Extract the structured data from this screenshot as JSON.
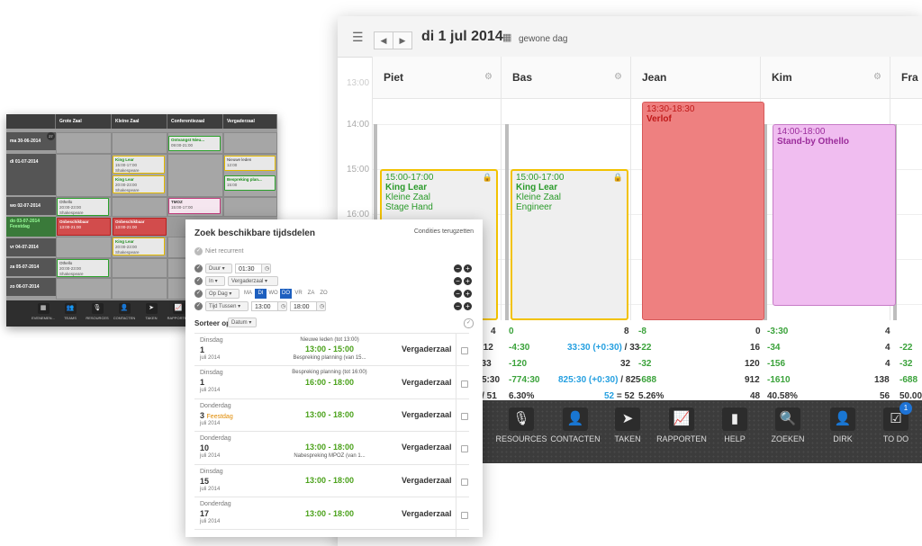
{
  "calendar": {
    "date_title": "di 1 jul 2014",
    "day_type": "gewone dag",
    "columns": [
      "Piet",
      "Bas",
      "Jean",
      "Kim",
      "Fra"
    ],
    "times": [
      "13:00",
      "14:00",
      "15:00",
      "16:00"
    ],
    "events": {
      "piet": {
        "time": "15:00-17:00",
        "title": "King Lear",
        "room": "Kleine Zaal",
        "role": "Stage Hand"
      },
      "bas": {
        "time": "15:00-17:00",
        "title": "King Lear",
        "room": "Kleine Zaal",
        "role": "Engineer"
      },
      "jean": {
        "time": "13:30-18:30",
        "title": "Verlof"
      },
      "kim": {
        "time": "14:00-18:00",
        "title": "Stand-by Othello"
      }
    },
    "stats": [
      {
        "a1": "4",
        "a2": ") / 21",
        "b1": "0",
        "b2": "8",
        "c1": "-8",
        "c2": "0",
        "d1": "-3:30",
        "d2": "4"
      },
      {
        "a1": "4",
        "a2": ") / 12",
        "b1": "-4:30",
        "b_mid": "33:30 (+0:30)",
        "b_mid_rest": " / 33",
        "c1": "-22",
        "c2": "16",
        "d1": "-34",
        "d2": "4",
        "e1": "-22"
      },
      {
        "a1": "",
        "a2": "/ 33",
        "b1": "-120",
        "b2": "32",
        "c1": "-32",
        "c2": "120",
        "d1": "-156",
        "d2": "4",
        "e1": "-32"
      },
      {
        "a1": "",
        "a2": "5:30",
        "b1": "-774:30",
        "b_mid": "825:30 (+0:30)",
        "b_mid_rest": " / 825",
        "c1": "-688",
        "c2": "912",
        "d1": "-1610",
        "d2": "138",
        "e1": "-688"
      },
      {
        "a1": "",
        "a2": ") / 51",
        "b1": "6.30%",
        "b_mid": "52",
        "b_mid_rest": " = 52",
        "c1": "5.26%",
        "c2": "48",
        "d1": "40.58%",
        "d2": "56",
        "e1": "50.00"
      }
    ],
    "footer": [
      {
        "label": "RESOURCES",
        "icon": "microphone-icon"
      },
      {
        "label": "CONTACTEN",
        "icon": "contact-card-icon"
      },
      {
        "label": "TAKEN",
        "icon": "paper-plane-icon"
      },
      {
        "label": "RAPPORTEN",
        "icon": "chart-icon"
      },
      {
        "label": "HELP",
        "icon": "bookmark-icon"
      },
      {
        "label": "ZOEKEN",
        "icon": "search-icon"
      },
      {
        "label": "DIRK",
        "icon": "user-icon"
      },
      {
        "label": "TO DO",
        "icon": "checkbox-icon",
        "badge": "1"
      }
    ]
  },
  "month": {
    "columns": [
      "Grote Zaal",
      "Kleine Zaal",
      "Conferentiezaal",
      "Vergaderzaal"
    ],
    "corner_badge": "27",
    "days": [
      {
        "label": "ma 30-06-2014"
      },
      {
        "label": "di 01-07-2014"
      },
      {
        "label": "wo 02-07-2014"
      },
      {
        "label": "do 03-07-2014",
        "sub": "Feestdag"
      },
      {
        "label": "vr 04-07-2014"
      },
      {
        "label": "za 05-07-2014"
      },
      {
        "label": "zo 06-07-2014"
      }
    ],
    "events": {
      "e1_title": "Ontvangst Nieu...",
      "e1_time": "09:00-21:00",
      "e2_title": "King Lear",
      "e2_time": "15:00-17:00",
      "e2_loc": "Shakespeare",
      "e3_title": "Nieuwe leden",
      "e3_time": "12:00",
      "e4_title": "King Lear",
      "e4_time": "20:00-23:00",
      "e4_loc": "Shakespeare",
      "e5_title": "Bespreking plan...",
      "e5_time": "15:00",
      "e6_title": "Othello",
      "e6_time": "20:00-23:00",
      "e6_loc": "Shakespeare",
      "e7_title": "TMOZ",
      "e7_time": "15:00-17:00",
      "e8_title": "Onbeschikbaar",
      "e8_time": "13:00-21:00",
      "e9_title": "Onbeschikbaar",
      "e9_time": "13:00-21:00",
      "e10_title": "King Lear",
      "e10_time": "20:00-23:00",
      "e10_loc": "Shakespeare",
      "e11_title": "Othello",
      "e11_time": "20:00-23:00",
      "e11_loc": "Shakespeare"
    },
    "footer": [
      "EVENEMEN...",
      "TEAMS",
      "RESOURCES",
      "CONTACTEN",
      "TAKEN",
      "RAPPORTEN"
    ]
  },
  "search": {
    "title": "Zoek beschikbare tijdsdelen",
    "reset": "Condities terugzetten",
    "recurrent": "Niet recurrent",
    "duur_label": "Duur",
    "duur_value": "01:30",
    "in_label": "In",
    "in_value": "Vergaderzaal",
    "opdag_label": "Op Dag",
    "days": [
      "MA",
      "DI",
      "WO",
      "DO",
      "VR",
      "ZA",
      "ZO"
    ],
    "tijd_label": "Tijd Tussen",
    "tijd_from": "13:00",
    "tijd_to": "18:00",
    "sort_label": "Sorteer op",
    "sort_value": "Datum",
    "results": [
      {
        "dayname": "Dinsdag",
        "daynum": "1",
        "month": "juli 2014",
        "note": "Nieuwe leden (tot 13:00)",
        "time": "13:00 - 15:00",
        "note2": "Bespreking planning (van 15...",
        "room": "Vergaderzaal"
      },
      {
        "dayname": "Dinsdag",
        "daynum": "1",
        "month": "juli 2014",
        "note": "Bespreking planning (tot 16:00)",
        "time": "16:00 - 18:00",
        "room": "Vergaderzaal"
      },
      {
        "dayname": "Donderdag",
        "daynum": "3",
        "tag": "Feestdag",
        "month": "juli 2014",
        "time": "13:00 - 18:00",
        "room": "Vergaderzaal"
      },
      {
        "dayname": "Donderdag",
        "daynum": "10",
        "month": "juli 2014",
        "time": "13:00 - 18:00",
        "note2": "Nabespreking MPOZ (van 1...",
        "room": "Vergaderzaal"
      },
      {
        "dayname": "Dinsdag",
        "daynum": "15",
        "month": "juli 2014",
        "time": "13:00 - 18:00",
        "room": "Vergaderzaal"
      },
      {
        "dayname": "Donderdag",
        "daynum": "17",
        "month": "juli 2014",
        "time": "13:00 - 18:00",
        "room": "Vergaderzaal"
      }
    ]
  }
}
